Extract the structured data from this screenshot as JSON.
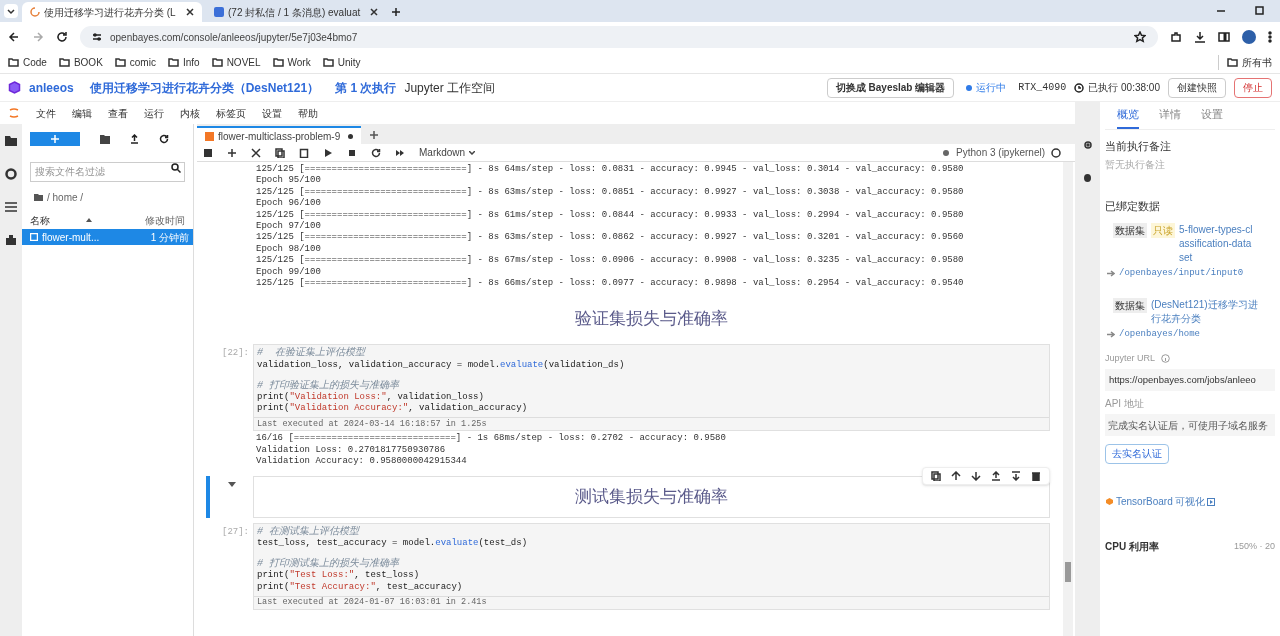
{
  "browser": {
    "tabs": [
      {
        "title": "使用迁移学习进行花卉分类 (L",
        "selected": true
      },
      {
        "title": "(72 封私信 / 1 条消息) evaluat",
        "selected": false
      }
    ],
    "address": "openbayes.com/console/anleeos/jupyter/5e7j03e4bmo7",
    "bookmarks": [
      "Code",
      "BOOK",
      "comic",
      "Info",
      "NOVEL",
      "Work",
      "Unity"
    ],
    "bookmarks_right": "所有书"
  },
  "header": {
    "user": "anleeos",
    "project": "使用迁移学习进行花卉分类（DesNet121）",
    "run": "第 1 次执行",
    "workspace": "Jupyter 工作空间",
    "switch_button": "切换成 Bayeslab 编辑器",
    "status": "运行中",
    "gpu": "RTX_4090",
    "elapsed": "已执行 00:38:00",
    "snapshot_button": "创建快照",
    "stop_button": "停止"
  },
  "menu": [
    "文件",
    "编辑",
    "查看",
    "运行",
    "内核",
    "标签页",
    "设置",
    "帮助"
  ],
  "file_browser": {
    "search_placeholder": "搜索文件名过滤",
    "path": "/ home /",
    "columns": [
      "名称",
      "修改时间"
    ],
    "files": [
      {
        "name": "flower-mult...",
        "modified": "1 分钟前",
        "selected": true
      }
    ]
  },
  "notebook": {
    "tab": "flower-multiclass-problem-9",
    "cell_type": "Markdown",
    "kernel": "Python 3 (ipykernel)",
    "cells": [
      {
        "kind": "output",
        "lines": [
          "125/125 [==============================] - 8s 64ms/step - loss: 0.0831 - accuracy: 0.9945 - val_loss: 0.3014 - val_accuracy: 0.9580",
          "Epoch 95/100",
          "125/125 [==============================] - 8s 63ms/step - loss: 0.0851 - accuracy: 0.9927 - val_loss: 0.3038 - val_accuracy: 0.9580",
          "Epoch 96/100",
          "125/125 [==============================] - 8s 61ms/step - loss: 0.0844 - accuracy: 0.9933 - val_loss: 0.2994 - val_accuracy: 0.9580",
          "Epoch 97/100",
          "125/125 [==============================] - 8s 63ms/step - loss: 0.0862 - accuracy: 0.9927 - val_loss: 0.3201 - val_accuracy: 0.9560",
          "Epoch 98/100",
          "125/125 [==============================] - 8s 67ms/step - loss: 0.0906 - accuracy: 0.9908 - val_loss: 0.3235 - val_accuracy: 0.9580",
          "Epoch 99/100",
          "125/125 [==============================] - 8s 66ms/step - loss: 0.0977 - accuracy: 0.9898 - val_loss: 0.2954 - val_accuracy: 0.9540"
        ]
      },
      {
        "kind": "markdown",
        "text": "验证集损失与准确率",
        "selected": false
      },
      {
        "kind": "code",
        "prompt": "[22]:",
        "blocks": [
          [
            [
              {
                "kind": "comment",
                "text": "#  在验证集上评估模型"
              }
            ],
            [
              {
                "kind": "plain",
                "text": "validation_loss, validation_accuracy = model."
              },
              {
                "kind": "fn",
                "text": "evaluate"
              },
              {
                "kind": "plain",
                "text": "(validation_ds)"
              }
            ]
          ],
          [
            [
              {
                "kind": "comment",
                "text": "# 打印验证集上的损失与准确率"
              }
            ],
            [
              {
                "kind": "plain",
                "text": "print("
              },
              {
                "kind": "string",
                "text": "\"Validation Loss:\""
              },
              {
                "kind": "plain",
                "text": ", validation_loss)"
              }
            ],
            [
              {
                "kind": "plain",
                "text": "print("
              },
              {
                "kind": "string",
                "text": "\"Validation Accuracy:\""
              },
              {
                "kind": "plain",
                "text": ", validation_accuracy)"
              }
            ]
          ]
        ],
        "executed": "Last executed at 2024-03-14 16:18:57 in 1.25s"
      },
      {
        "kind": "output",
        "lines": [
          "16/16 [==============================] - 1s 68ms/step - loss: 0.2702 - accuracy: 0.9580",
          "Validation Loss: 0.2701817750930786",
          "Validation Accuracy: 0.9580000042915344"
        ]
      },
      {
        "kind": "markdown",
        "text": "测试集损失与准确率",
        "selected": true
      },
      {
        "kind": "code",
        "prompt": "[27]:",
        "blocks": [
          [
            [
              {
                "kind": "comment",
                "text": "# 在测试集上评估模型"
              }
            ],
            [
              {
                "kind": "plain",
                "text": "test_loss, test_accuracy = model."
              },
              {
                "kind": "fn",
                "text": "evaluate"
              },
              {
                "kind": "plain",
                "text": "(test_ds)"
              }
            ]
          ],
          [
            [
              {
                "kind": "comment",
                "text": "# 打印测试集上的损失与准确率"
              }
            ],
            [
              {
                "kind": "plain",
                "text": "print("
              },
              {
                "kind": "string",
                "text": "\"Test Loss:\""
              },
              {
                "kind": "plain",
                "text": ", test_loss)"
              }
            ],
            [
              {
                "kind": "plain",
                "text": "print("
              },
              {
                "kind": "string",
                "text": "\"Test Accuracy:\""
              },
              {
                "kind": "plain",
                "text": ", test_accuracy)"
              }
            ]
          ]
        ],
        "executed": "Last executed at 2024-01-07 16:03:01 in 2.41s"
      }
    ]
  },
  "panel": {
    "tabs": [
      {
        "label": "概览",
        "selected": true
      },
      {
        "label": "详情",
        "selected": false
      },
      {
        "label": "设置",
        "selected": false
      }
    ],
    "note_title": "当前执行备注",
    "note": "暂无执行备注",
    "data_title": "已绑定数据",
    "datasets": [
      {
        "badge": "数据集",
        "tag": "只读",
        "name": "5-flower-types-classification-dataset",
        "path": "/openbayes/input/input0"
      },
      {
        "badge": "数据集",
        "name": "(DesNet121)迁移学习进行花卉分类",
        "path": "/openbayes/home"
      }
    ],
    "url_label": "Jupyter URL",
    "url": "https://openbayes.com/jobs/anleeo",
    "api_label": "API 地址",
    "api": "完成实名认证后，可使用子域名服务",
    "verify_button": "去实名认证",
    "tensorboard": "TensorBoard 可视化",
    "cpu_label": "CPU 利用率",
    "cpu_value": "150% · 20"
  }
}
